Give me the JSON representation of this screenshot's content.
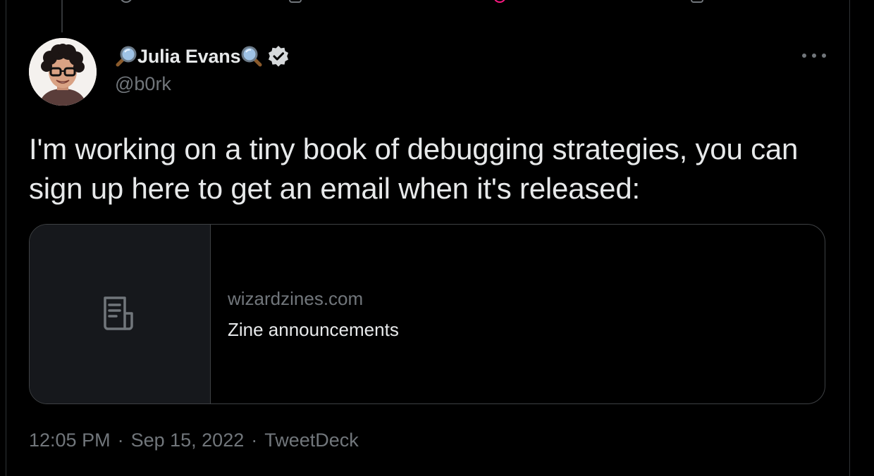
{
  "tweet": {
    "author": {
      "display_name": "Julia Evans",
      "handle": "@b0rk",
      "name_prefix_icon": "magnifying-glass-tilted-left-icon",
      "name_suffix_icon": "magnifying-glass-tilted-right-icon",
      "verified": true
    },
    "text": "I'm working on a tiny book of debugging strategies, you can sign up here to get an email when it's released:",
    "card": {
      "domain": "wizardzines.com",
      "title": "Zine announcements",
      "thumb_icon": "document-icon"
    },
    "meta": {
      "time": "12:05 PM",
      "date": "Sep 15, 2022",
      "source": "TweetDeck",
      "separator": "·"
    },
    "more_icon": "more-options-icon"
  },
  "colors": {
    "background": "#000000",
    "primary_text": "#e7e9ea",
    "secondary_text": "#71767b",
    "border": "#3e4144",
    "card_thumb_bg": "#16181c"
  }
}
